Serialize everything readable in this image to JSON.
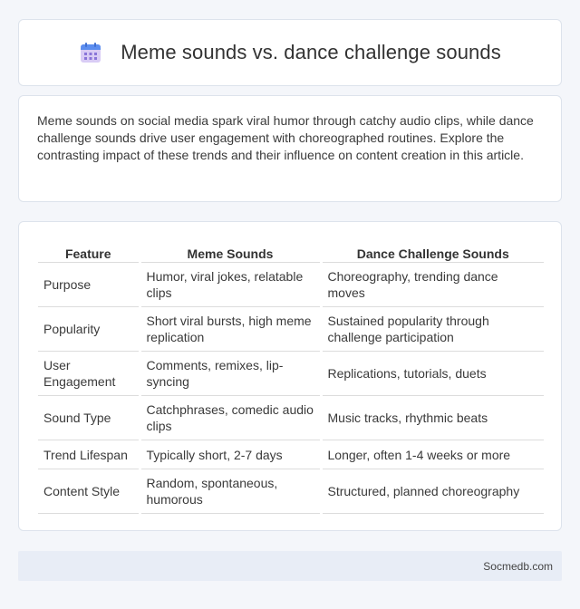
{
  "header": {
    "icon": "calendar-icon",
    "title": "Meme sounds vs. dance challenge sounds"
  },
  "intro": {
    "text": "Meme sounds on social media spark viral humor through catchy audio clips, while dance challenge sounds drive user engagement with choreographed routines. Explore the contrasting impact of these trends and their influence on content creation in this article."
  },
  "table": {
    "headers": [
      "Feature",
      "Meme Sounds",
      "Dance Challenge Sounds"
    ],
    "rows": [
      [
        "Purpose",
        "Humor, viral jokes, relatable clips",
        "Choreography, trending dance moves"
      ],
      [
        "Popularity",
        "Short viral bursts, high meme replication",
        "Sustained popularity through challenge participation"
      ],
      [
        "User Engagement",
        "Comments, remixes, lip-syncing",
        "Replications, tutorials, duets"
      ],
      [
        "Sound Type",
        "Catchphrases, comedic audio clips",
        "Music tracks, rhythmic beats"
      ],
      [
        "Trend Lifespan",
        "Typically short, 2-7 days",
        "Longer, often 1-4 weeks or more"
      ],
      [
        "Content Style",
        "Random, spontaneous, humorous",
        "Structured, planned choreography"
      ]
    ]
  },
  "footer": {
    "site": "Socmedb.com"
  },
  "colors": {
    "background": "#f4f6fa",
    "card": "#ffffff",
    "footer": "#e8edf6",
    "icon_top": "#5b8def",
    "icon_body": "#c9b8f0"
  }
}
